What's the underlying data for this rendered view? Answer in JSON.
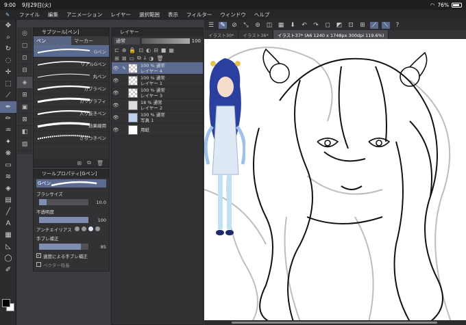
{
  "status": {
    "time": "9:00",
    "date": "9月29日(火)",
    "battery": "76%"
  },
  "menu": [
    "ファイル",
    "編集",
    "アニメーション",
    "レイヤー",
    "選択範囲",
    "表示",
    "フィルター",
    "ウィンドウ",
    "ヘルプ"
  ],
  "subtool": {
    "title": "サブツール[ペン]",
    "tabs": [
      "ペン",
      "マーカー"
    ],
    "brushes": [
      "Gペン",
      "リアルGペン",
      "丸ペン",
      "カブラペン",
      "カリグラフィ",
      "入り抜きペン",
      "効果線用",
      "ざらつきペン"
    ]
  },
  "toolprop": {
    "title": "ツールプロパティ[Gペン]",
    "name": "Gペン",
    "brush_size_label": "ブラシサイズ",
    "brush_size": "10.0",
    "brush_size_level": 0.15,
    "opacity_label": "不透明度",
    "opacity": "100",
    "opacity_level": 1.0,
    "aa_label": "アンチエイリアス",
    "stab_label": "手ブレ補正",
    "stab": "85",
    "stab_level": 0.85,
    "speed_label": "速度による手ブレ補正",
    "vector_label": "ベクター吸着"
  },
  "layers": {
    "title": "レイヤー",
    "blend_mode": "通常",
    "opacity": "100",
    "items": [
      {
        "mode": "100 % 通常",
        "name": "レイヤー 4",
        "active": true
      },
      {
        "mode": "100 % 通常",
        "name": "レイヤー 1",
        "active": false
      },
      {
        "mode": "100 % 通常",
        "name": "レイヤー 3",
        "active": false
      },
      {
        "mode": "18 % 通常",
        "name": "レイヤー 2",
        "active": false
      },
      {
        "mode": "100 % 通常",
        "name": "写真 1",
        "active": false
      },
      {
        "mode": "",
        "name": "用紙",
        "active": false
      }
    ]
  },
  "doc_tabs": [
    "イラスト30*",
    "イラスト36*",
    "イラスト37* (A6 1240 x 1748px 300dpi 119.6%)"
  ],
  "colors": {
    "accent": "#5b6a8f",
    "panel": "#323235",
    "fg": "#000000",
    "bg": "#ffffff"
  }
}
